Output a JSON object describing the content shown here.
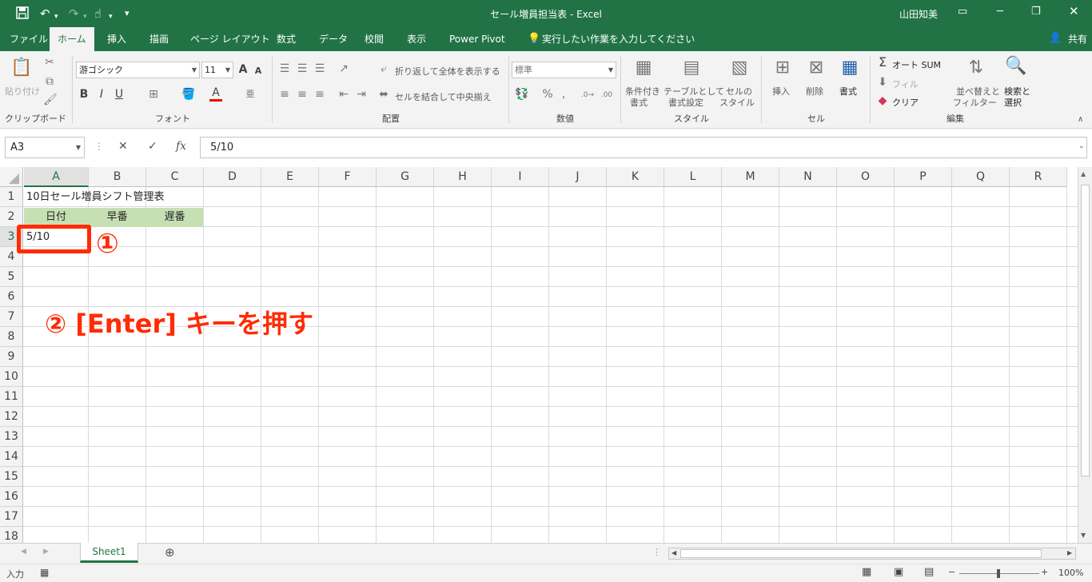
{
  "titlebar": {
    "doc_title": "セール増員担当表 - Excel",
    "user": "山田知美",
    "save_icon": "save-icon",
    "undo_icon": "undo-icon",
    "redo_icon": "redo-icon",
    "touch_icon": "touch-mode-icon"
  },
  "tabs": [
    "ファイル",
    "ホーム",
    "挿入",
    "描画",
    "ページ レイアウト",
    "数式",
    "データ",
    "校閲",
    "表示",
    "Power Pivot"
  ],
  "active_tab": "ホーム",
  "tell_me": "実行したい作業を入力してください",
  "share": "共有",
  "ribbon": {
    "clipboard": {
      "label": "クリップボード",
      "paste": "貼り付け"
    },
    "font": {
      "label": "フォント",
      "name": "游ゴシック",
      "size": "11",
      "bold": "B",
      "italic": "I",
      "underline": "U"
    },
    "alignment": {
      "label": "配置",
      "wrap": "折り返して全体を表示する",
      "merge": "セルを結合して中央揃え"
    },
    "number": {
      "label": "数値",
      "format": "標準"
    },
    "styles": {
      "label": "スタイル",
      "conditional1": "条件付き",
      "conditional2": "書式",
      "table1": "テーブルとして",
      "table2": "書式設定",
      "cell1": "セルの",
      "cell2": "スタイル"
    },
    "cells": {
      "label": "セル",
      "insert": "挿入",
      "delete": "削除",
      "format": "書式"
    },
    "editing": {
      "label": "編集",
      "autosum": "オート SUM",
      "fill": "フィル",
      "clear": "クリア",
      "sort1": "並べ替えと",
      "sort2": "フィルター",
      "find1": "検索と",
      "find2": "選択"
    }
  },
  "formula_bar": {
    "name_box": "A3",
    "formula": "5/10",
    "fx": "fx"
  },
  "columns": [
    "A",
    "B",
    "C",
    "D",
    "E",
    "F",
    "G",
    "H",
    "I",
    "J",
    "K",
    "L",
    "M",
    "N",
    "O",
    "P",
    "Q",
    "R"
  ],
  "rows": [
    "1",
    "2",
    "3",
    "4",
    "5",
    "6",
    "7",
    "8",
    "9",
    "10",
    "11",
    "12",
    "13",
    "14",
    "15",
    "16",
    "17",
    "18"
  ],
  "cells": {
    "A1": "10日セール増員シフト管理表",
    "A2": "日付",
    "B2": "早番",
    "C2": "遅番",
    "A3": "5/10"
  },
  "header_fill_color": "#c6e0b4",
  "annotations": {
    "step1": "①",
    "step2": "② [Enter] キーを押す",
    "color": "#ff2b06"
  },
  "sheet_tab": "Sheet1",
  "status": {
    "mode": "入力",
    "zoom": "100%"
  }
}
